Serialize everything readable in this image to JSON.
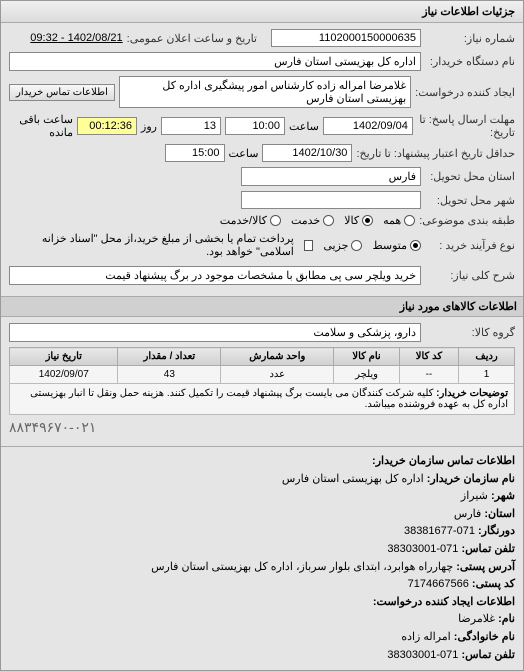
{
  "header": {
    "title": "جزئیات اطلاعات نیاز"
  },
  "form": {
    "reqno_label": "شماره نیاز:",
    "reqno": "1102000150000635",
    "pubdate_label": "تاریخ و ساعت اعلان عمومی:",
    "pubdate": "1402/08/21 - 09:32",
    "buyer_org_label": "نام دستگاه خریدار:",
    "buyer_org": "اداره کل بهزیستی استان فارس",
    "creator_label": "ایجاد کننده درخواست:",
    "creator": "غلامرضا امراله زاده کارشناس امور پیشگیری اداره کل بهزیستی استان فارس",
    "contact_btn": "اطلاعات تماس خریدار",
    "deadline_label": "مهلت ارسال پاسخ: تا تاریخ:",
    "deadline_date": "1402/09/04",
    "deadline_time_label": "ساعت",
    "deadline_time": "10:00",
    "days": "13",
    "days_label": "روز",
    "remain_time": "00:12:36",
    "remain_label": "ساعت باقی مانده",
    "delivery_label": "حداقل تاریخ اعتبار پیشنهاد: تا تاریخ:",
    "delivery_date": "1402/10/30",
    "delivery_time_label": "ساعت",
    "delivery_time": "15:00",
    "province_label": "استان محل تحویل:",
    "province": "فارس",
    "city_label": "شهر محل تحویل:",
    "category_label": "طبقه بندی موضوعی:",
    "radio_all": "همه",
    "radio_goods": "کالا",
    "radio_service": "خدمت",
    "radio_goodservice": "کالا/خدمت",
    "purchase_type_label": "نوع فرآیند خرید :",
    "radio_medium": "متوسط",
    "radio_minor": "جزیی",
    "payment_note": "پرداخت تمام یا بخشی از مبلغ خرید،از محل \"اسناد خزانه اسلامی\" خواهد بود.",
    "desc_label": "شرح کلی نیاز:",
    "desc": "خرید ویلچر سی پی مطابق با مشخصات موجود در برگ پیشنهاد قیمت",
    "goods_title": "اطلاعات کالاهای مورد نیاز",
    "group_label": "گروه کالا:",
    "group": "دارو، پزشکی و سلامت"
  },
  "table": {
    "headers": {
      "row": "ردیف",
      "code": "کد کالا",
      "name": "نام کالا",
      "unit": "واحد شمارش",
      "qty": "تعداد / مقدار",
      "date": "تاریخ نیاز"
    },
    "rows": [
      {
        "row": "1",
        "code": "--",
        "name": "ویلچر",
        "unit": "عدد",
        "qty": "43",
        "date": "1402/09/07"
      }
    ],
    "note_label": "توضیحات خریدار:",
    "note": "کلیه شرکت کنندگان می بایست برگ پیشنهاد قیمت را تکمیل کنند. هزینه حمل ونقل تا انبار بهزیستی اداره کل به عهده فروشنده میباشد."
  },
  "contact": {
    "section_title": "اطلاعات تماس سازمان خریدار:",
    "org_label": "نام سازمان خریدار:",
    "org": "اداره کل بهزیستی استان فارس",
    "city_label": "شهر:",
    "city": "شیراز",
    "province_label": "استان:",
    "province": "فارس",
    "fax_label": "دورنگار:",
    "fax": "071-38381677",
    "phone_label": "تلفن تماس:",
    "phone": "071-38303001",
    "address_label": "آدرس پستی:",
    "address": "چهارراه هوابرد، ابتدای بلوار سرباز، اداره کل بهزیستی استان فارس",
    "postal_label": "کد پستی:",
    "postal": "7174667566",
    "creator_section": "اطلاعات ایجاد کننده درخواست:",
    "cname_label": "نام:",
    "cname": "غلامرضا",
    "clast_label": "نام خانوادگی:",
    "clast": "امراله زاده",
    "cphone_label": "تلفن تماس:",
    "cphone": "071-38303001",
    "footer_phone": "۸۸۳۴۹۶۷۰-۰۲۱"
  }
}
